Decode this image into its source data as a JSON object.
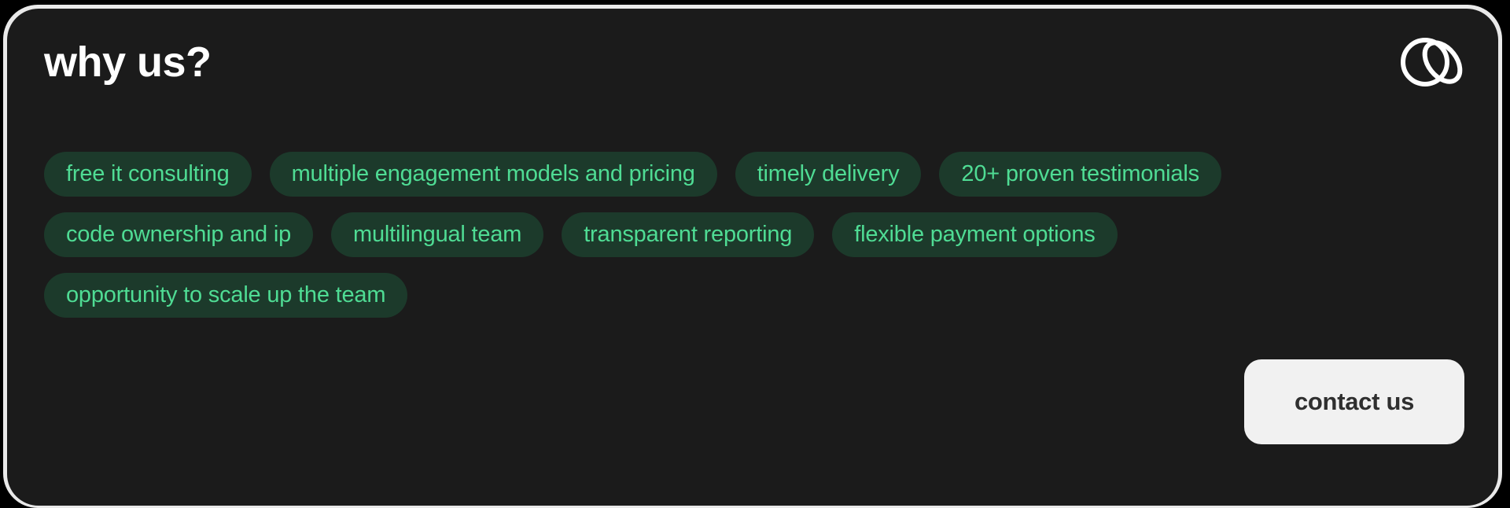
{
  "card": {
    "title": "why us?",
    "background_color": "#1b1b1b",
    "border_color": "#e9e9e9"
  },
  "logo": {
    "name": "interlocked-circles-logo",
    "color": "#ffffff"
  },
  "tags": {
    "text_color": "#4fdc94",
    "background_color": "#1c3a2b",
    "items": [
      {
        "label": "free it consulting"
      },
      {
        "label": "multiple engagement models and pricing"
      },
      {
        "label": "timely delivery"
      },
      {
        "label": "20+ proven testimonials"
      },
      {
        "label": "code ownership and ip"
      },
      {
        "label": "multilingual team"
      },
      {
        "label": "transparent reporting"
      },
      {
        "label": "flexible payment options"
      },
      {
        "label": "opportunity to scale up the team"
      }
    ]
  },
  "cta": {
    "label": "contact us",
    "background_color": "#f1f1f1",
    "text_color": "#2f2f2f"
  }
}
